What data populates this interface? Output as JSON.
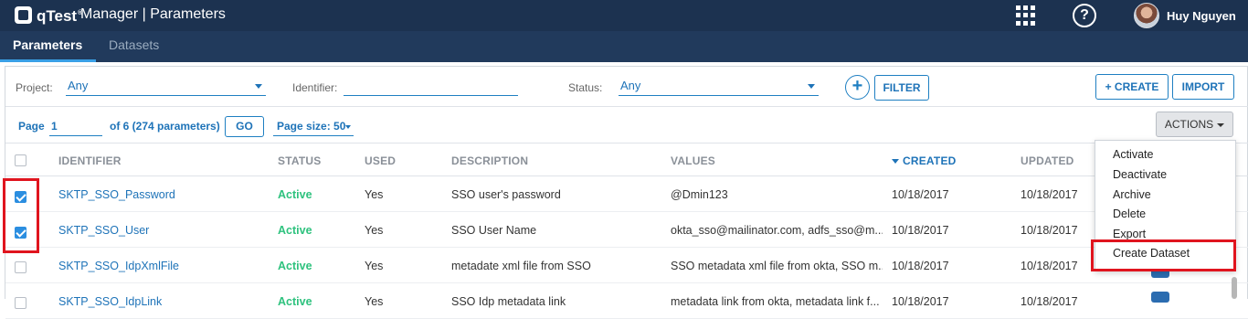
{
  "header": {
    "brand": "qTest",
    "brand_mark": "®",
    "title": "Manager | Parameters",
    "user_name": "Huy Nguyen"
  },
  "tabs": [
    {
      "label": "Parameters",
      "active": true
    },
    {
      "label": "Datasets",
      "active": false
    }
  ],
  "filters": {
    "project_label": "Project:",
    "project_value": "Any",
    "identifier_label": "Identifier:",
    "identifier_value": "",
    "status_label": "Status:",
    "status_value": "Any",
    "filter_button": "FILTER",
    "create_button": "+ CREATE",
    "import_button": "IMPORT"
  },
  "paging": {
    "page_label": "Page",
    "page_value": "1",
    "of_text": "of 6 (274 parameters)",
    "go_button": "GO",
    "page_size_label": "Page size: 50",
    "actions_button": "ACTIONS"
  },
  "columns": {
    "identifier": "IDENTIFIER",
    "status": "STATUS",
    "used": "USED",
    "description": "DESCRIPTION",
    "values": "VALUES",
    "created": "CREATED",
    "updated": "UPDATED"
  },
  "rows": [
    {
      "checked": true,
      "identifier": "SKTP_SSO_Password",
      "status": "Active",
      "used": "Yes",
      "description": "SSO user's password",
      "values": "@Dmin123",
      "created": "10/18/2017",
      "updated": "10/18/2017"
    },
    {
      "checked": true,
      "identifier": "SKTP_SSO_User",
      "status": "Active",
      "used": "Yes",
      "description": "SSO User Name",
      "values": "okta_sso@mailinator.com, adfs_sso@m...",
      "created": "10/18/2017",
      "updated": "10/18/2017"
    },
    {
      "checked": false,
      "identifier": "SKTP_SSO_IdpXmlFile",
      "status": "Active",
      "used": "Yes",
      "description": "metadate xml file from SSO",
      "values": "SSO metadata xml file from okta, SSO m...",
      "created": "10/18/2017",
      "updated": "10/18/2017"
    },
    {
      "checked": false,
      "identifier": "SKTP_SSO_IdpLink",
      "status": "Active",
      "used": "Yes",
      "description": "SSO Idp metadata link",
      "values": "metadata link from okta, metadata link f...",
      "created": "10/18/2017",
      "updated": "10/18/2017"
    }
  ],
  "actions_menu": [
    "Activate",
    "Deactivate",
    "Archive",
    "Delete",
    "Export",
    "Create Dataset"
  ],
  "colors": {
    "topbar": "#1c3250",
    "subnav": "#213a5c",
    "accent": "#1e73b8",
    "active_status": "#2ec27e",
    "highlight": "#e0141e"
  }
}
